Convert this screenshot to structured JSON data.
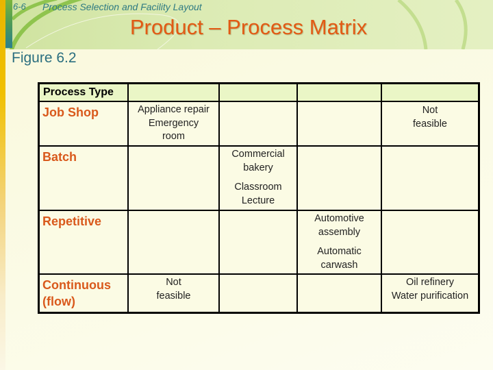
{
  "header": {
    "chapter_number": "6-6",
    "chapter_title": "Process Selection and Facility Layout",
    "slide_title": "Product – Process Matrix"
  },
  "figure_label": "Figure 6.2",
  "matrix": {
    "corner_header": "Process Type",
    "column_headers": [
      "",
      "",
      "",
      ""
    ],
    "rows": [
      {
        "process_type": "Job Shop",
        "cells": [
          [
            "Appliance repair\nEmergency\nroom"
          ],
          [],
          [],
          [
            "Not\nfeasible"
          ]
        ]
      },
      {
        "process_type": "Batch",
        "cells": [
          [],
          [
            "Commercial\nbakery",
            "Classroom\nLecture"
          ],
          [],
          []
        ]
      },
      {
        "process_type": "Repetitive",
        "cells": [
          [],
          [],
          [
            "Automotive\nassembly",
            "Automatic\ncarwash"
          ],
          []
        ]
      },
      {
        "process_type": "Continuous\n(flow)",
        "cells": [
          [
            "Not\nfeasible"
          ],
          [],
          [],
          [
            "Oil refinery\nWater purification"
          ]
        ]
      }
    ]
  },
  "colors": {
    "title": "#e25a14",
    "process_label": "#d9591c",
    "accent_teal": "#2a6e7f",
    "header_band": "#dcebb4",
    "table_header_fill": "#eaf6c6",
    "table_body_fill": "#fbfbe4"
  }
}
